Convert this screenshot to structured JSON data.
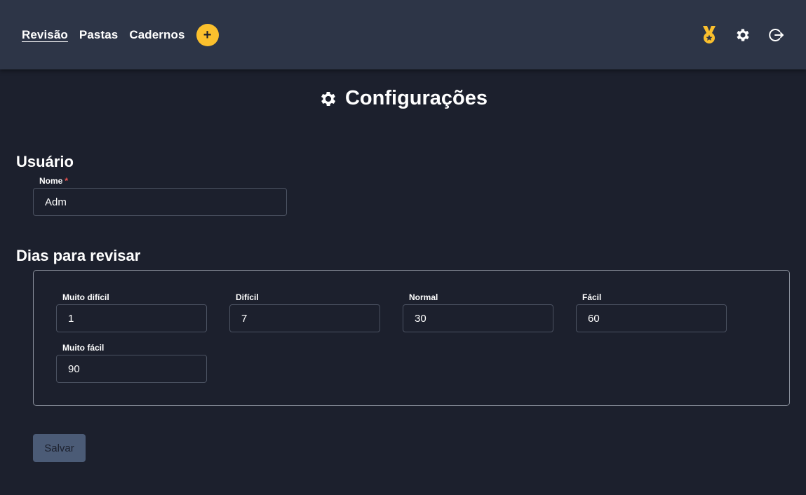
{
  "nav": {
    "links": [
      {
        "label": "Revisão",
        "active": true
      },
      {
        "label": "Pastas",
        "active": false
      },
      {
        "label": "Cadernos",
        "active": false
      }
    ],
    "add_label": "+",
    "icons": [
      "medal-icon",
      "gear-icon",
      "logout-icon"
    ]
  },
  "page": {
    "title": "Configurações",
    "title_icon": "gear-icon"
  },
  "user_section": {
    "title": "Usuário",
    "name_label": "Nome",
    "required_mark": "*",
    "name_value": "Adm"
  },
  "days_section": {
    "title": "Dias para revisar",
    "fields": [
      {
        "label": "Muito difícil",
        "value": "1"
      },
      {
        "label": "Difícil",
        "value": "7"
      },
      {
        "label": "Normal",
        "value": "30"
      },
      {
        "label": "Fácil",
        "value": "60"
      },
      {
        "label": "Muito fácil",
        "value": "90"
      }
    ]
  },
  "actions": {
    "save_label": "Salvar"
  },
  "colors": {
    "background": "#1c202d",
    "navbar": "#2d3547",
    "accent": "#fbc02d",
    "button_disabled": "#4b5b76"
  }
}
